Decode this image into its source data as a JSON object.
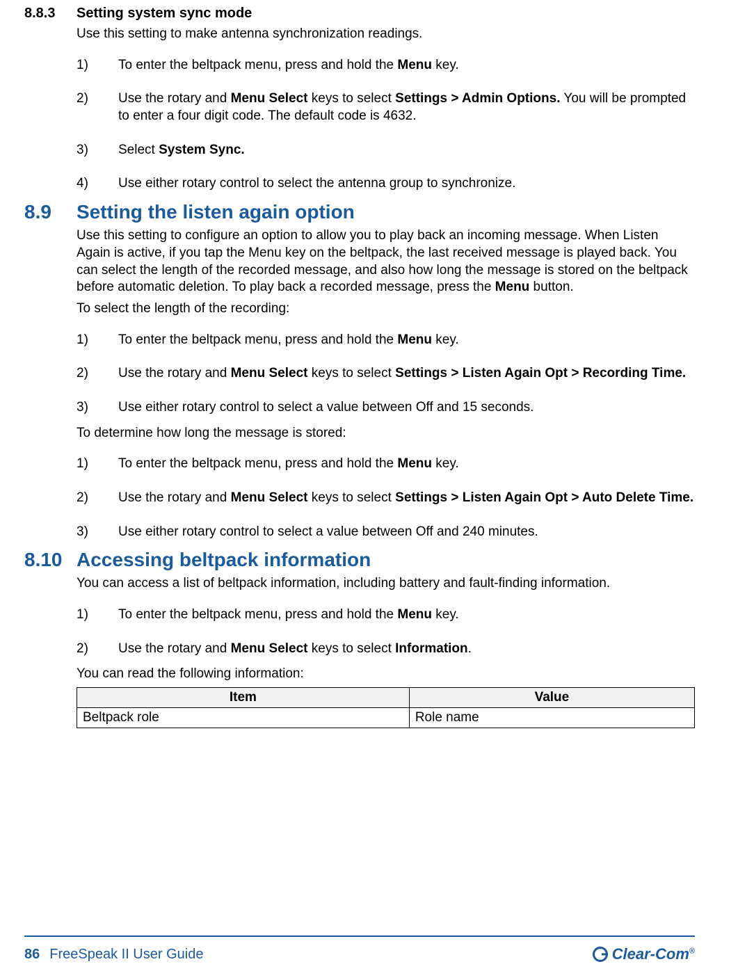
{
  "sec_883": {
    "num": "8.8.3",
    "title": "Setting system sync mode",
    "intro": "Use this setting to make antenna synchronization readings.",
    "steps": [
      {
        "marker": "1)",
        "pre": "To enter the beltpack menu, press and hold the ",
        "b1": "Menu",
        "post": " key."
      },
      {
        "marker": "2)",
        "pre": "Use the rotary and ",
        "b1": "Menu Select",
        "mid1": " keys to select ",
        "b2": "Settings > Admin Options.",
        "post": " You will be prompted to enter a four digit code. The default code is 4632."
      },
      {
        "marker": "3)",
        "pre": "Select ",
        "b1": "System Sync.",
        "post": ""
      },
      {
        "marker": "4)",
        "pre": "Use either rotary control to select the antenna group to synchronize.",
        "post": ""
      }
    ]
  },
  "sec_89": {
    "num": "8.9",
    "title": "Setting the listen again option",
    "intro_pre": "Use this setting to configure an option to allow you to play back an incoming message. When Listen Again is active, if you tap the Menu key on the beltpack, the last received message is played back. You can select the length of the recorded message, and also how long the message is stored on the beltpack before automatic deletion. To play back a recorded message, press the ",
    "intro_b": "Menu",
    "intro_post": " button.",
    "sub1": "To select the length of the recording:",
    "steps1": [
      {
        "marker": "1)",
        "pre": "To enter the beltpack menu, press and hold the ",
        "b1": "Menu",
        "post": " key."
      },
      {
        "marker": "2)",
        "pre": "Use the rotary and ",
        "b1": "Menu Select",
        "mid1": " keys to select ",
        "b2": "Settings > Listen Again Opt > Recording Time.",
        "post": ""
      },
      {
        "marker": "3)",
        "pre": "Use either rotary control to select a value between Off and 15 seconds.",
        "post": ""
      }
    ],
    "sub2": "To determine how long the message is stored:",
    "steps2": [
      {
        "marker": "1)",
        "pre": "To enter the beltpack menu, press and hold the ",
        "b1": "Menu",
        "post": " key."
      },
      {
        "marker": "2)",
        "pre": "Use the rotary and ",
        "b1": "Menu Select",
        "mid1": " keys to select ",
        "b2": "Settings > Listen Again Opt > Auto Delete Time.",
        "post": ""
      },
      {
        "marker": "3)",
        "pre": "Use either rotary control to select a value between Off and 240 minutes.",
        "post": ""
      }
    ]
  },
  "sec_810": {
    "num": "8.10",
    "title": "Accessing beltpack information",
    "intro": "You can access a list of beltpack information, including battery and fault-finding information.",
    "steps": [
      {
        "marker": "1)",
        "pre": "To enter the beltpack menu, press and hold the ",
        "b1": "Menu",
        "post": " key."
      },
      {
        "marker": "2)",
        "pre": "Use the rotary and ",
        "b1": "Menu Select",
        "mid1": " keys to select ",
        "b2": "Information",
        "post": "."
      }
    ],
    "outro": "You can read the following information:",
    "table": {
      "head_item": "Item",
      "head_value": "Value",
      "rows": [
        {
          "item": "Beltpack role",
          "value": "Role name"
        }
      ]
    }
  },
  "footer": {
    "page": "86",
    "guide": "FreeSpeak II User Guide",
    "brand": "Clear-Com",
    "reg": "®"
  }
}
